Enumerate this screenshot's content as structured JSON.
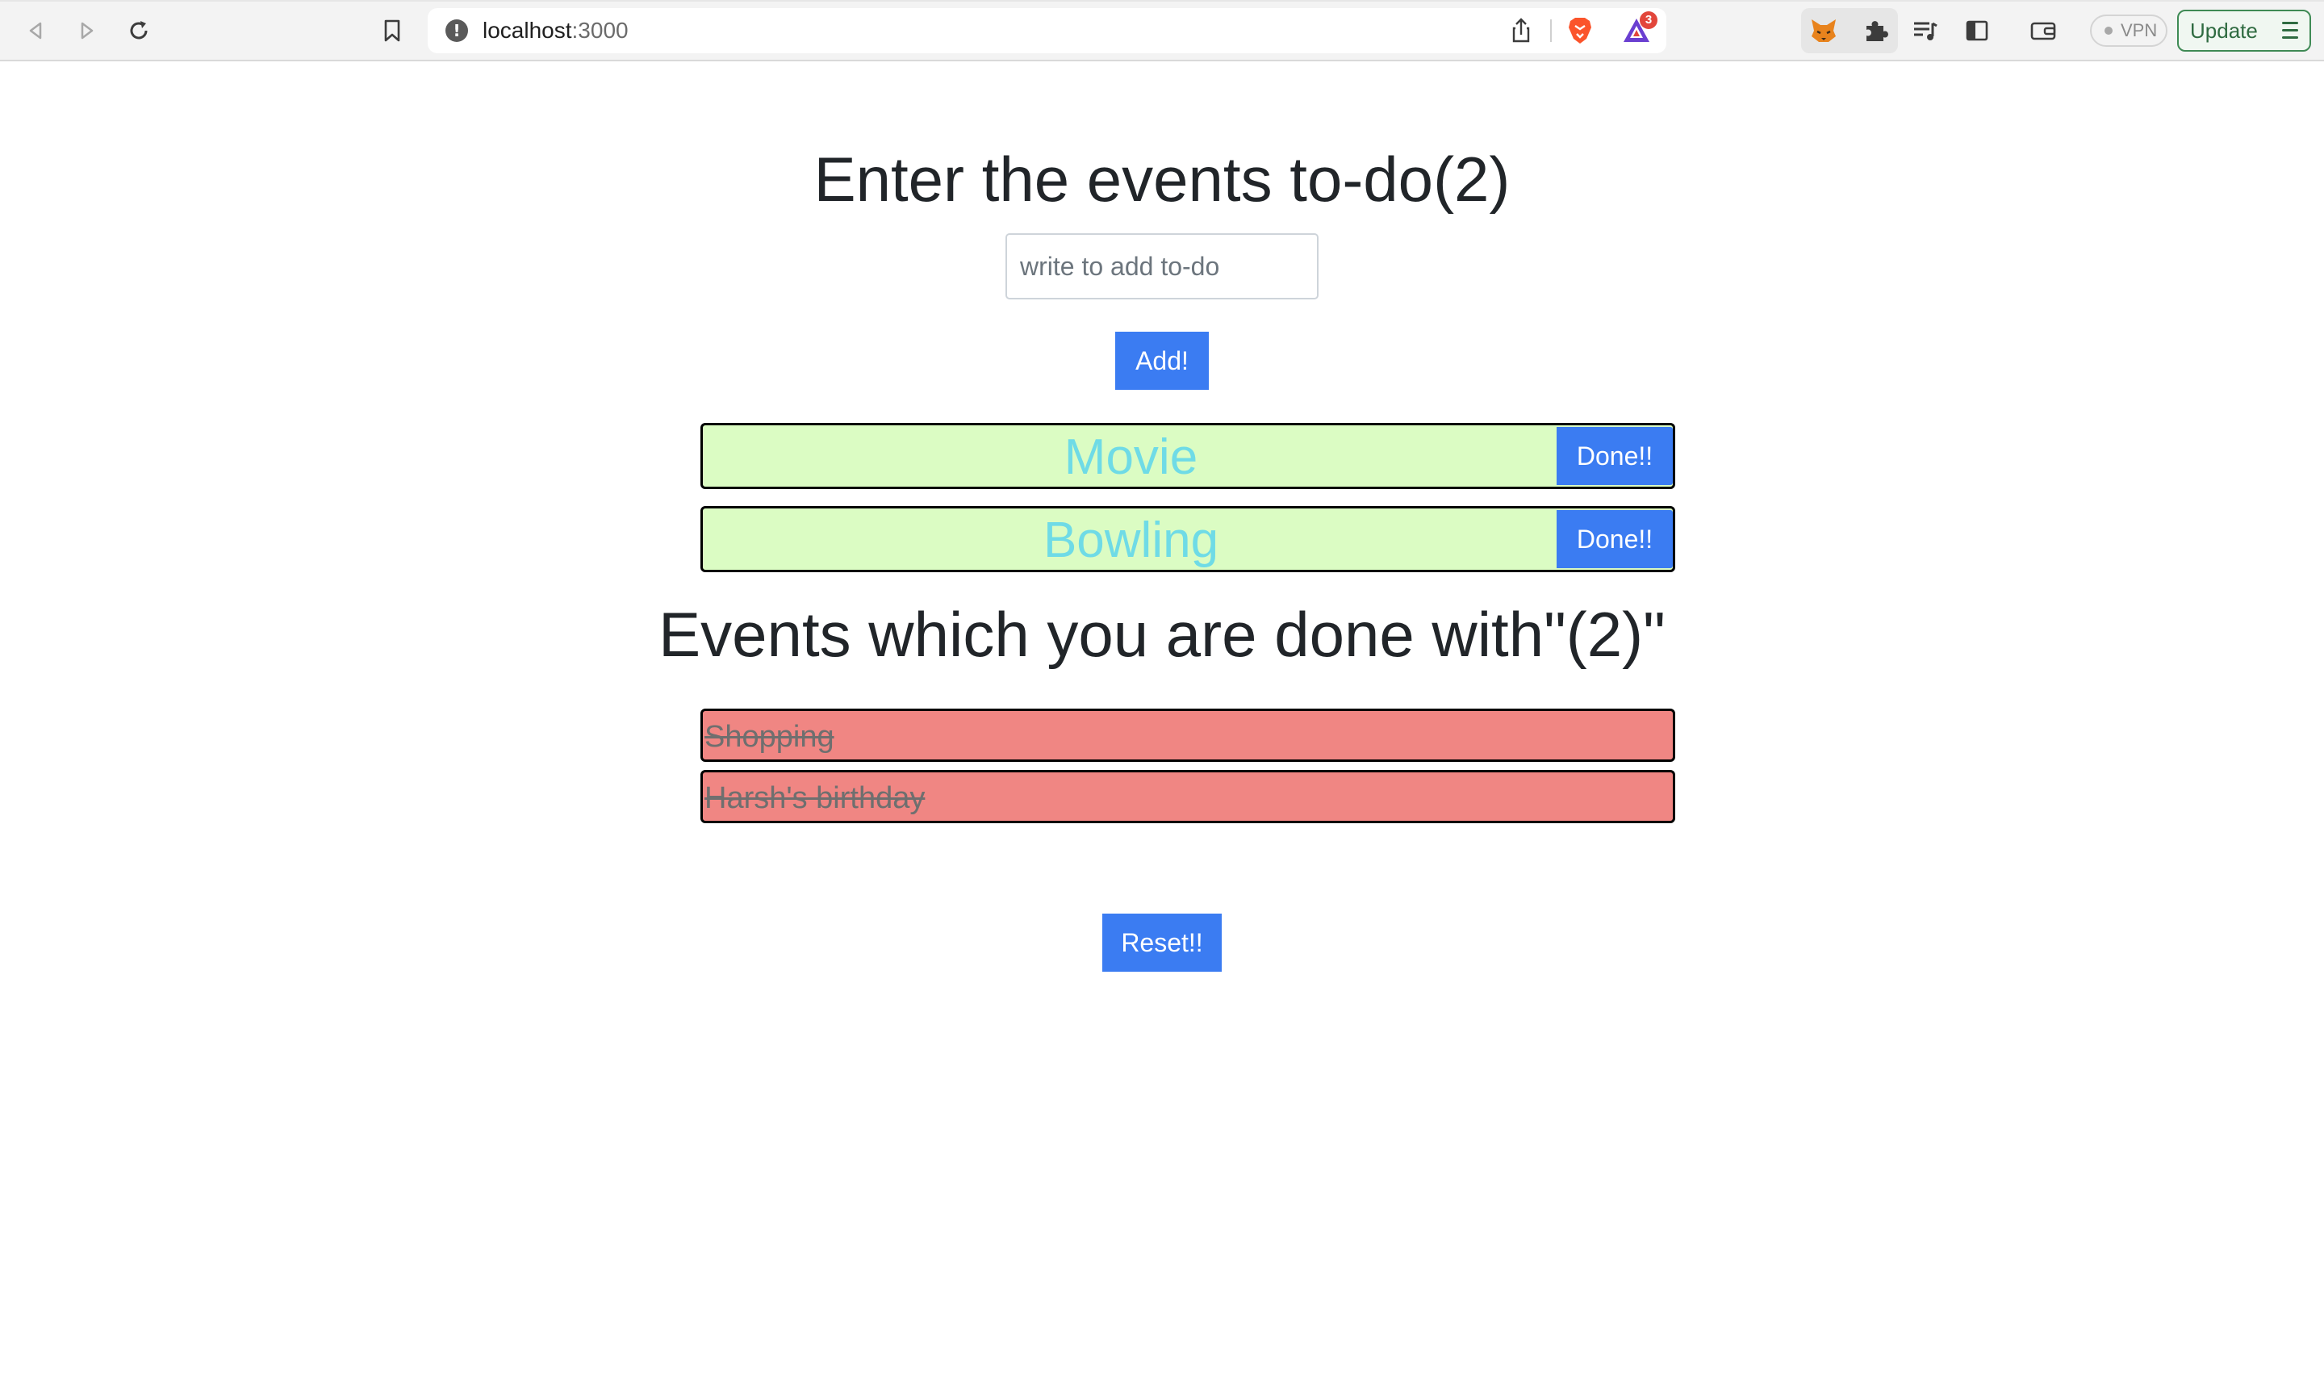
{
  "browser": {
    "url_host": "localhost",
    "url_port": ":3000",
    "rewards_badge_count": "3",
    "vpn_label": "VPN",
    "update_label": "Update",
    "icons": {
      "back": "back-arrow-icon",
      "forward": "forward-arrow-icon",
      "reload": "reload-icon",
      "bookmark": "bookmark-icon",
      "site_info": "info-icon",
      "share": "share-icon",
      "brave_shields": "brave-lion-icon",
      "rewards": "brave-rewards-icon",
      "metamask": "fox-icon",
      "extensions": "puzzle-icon",
      "playlist": "playlist-icon",
      "sidebar": "sidebar-icon",
      "wallet": "wallet-icon",
      "menu": "hamburger-menu-icon"
    },
    "colors": {
      "update_border": "#3f8a55",
      "update_text": "#2f6b41"
    }
  },
  "todo": {
    "heading": "Enter the events to-do(2)",
    "input_placeholder": "write to add to-do",
    "input_value": "",
    "add_label": "Add!",
    "items": [
      {
        "text": "Movie",
        "done_label": "Done!!"
      },
      {
        "text": "Bowling",
        "done_label": "Done!!"
      }
    ]
  },
  "done": {
    "heading": "Events which you are done with\"(2)\"",
    "items": [
      {
        "text": "Shopping"
      },
      {
        "text": "Harsh's birthday"
      }
    ]
  },
  "reset_label": "Reset!!",
  "colors": {
    "primary_button": "#3b7cf2",
    "todo_row_bg": "#dbfcc3",
    "todo_text": "#6fdbe6",
    "done_row_bg": "#f08683",
    "done_text": "#6f6f6f",
    "heading_text": "#212529"
  }
}
